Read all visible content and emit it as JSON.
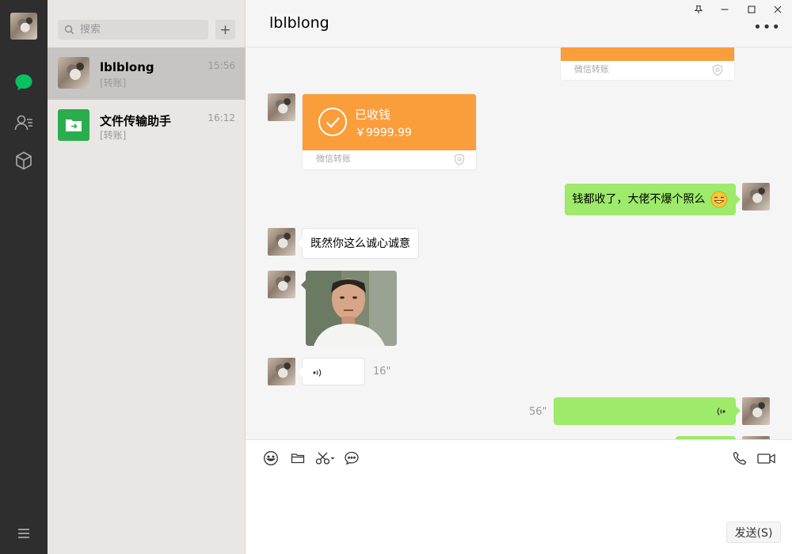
{
  "sidebar": {
    "nav": [
      "chat-icon",
      "contacts-icon",
      "favorites-icon",
      "menu-icon"
    ],
    "active_color": "#07c160"
  },
  "search": {
    "placeholder": "搜索",
    "add_label": "+"
  },
  "sessions": [
    {
      "name": "lblblong",
      "last": "[转账]",
      "time": "15:56",
      "active": true
    },
    {
      "name": "文件传输助手",
      "last": "[转账]",
      "time": "16:12",
      "active": false
    }
  ],
  "chat": {
    "title": "lblblong",
    "more": "•••",
    "window_controls": [
      "pin-icon",
      "minimize-icon",
      "maximize-icon",
      "close-icon"
    ],
    "messages": {
      "transfer_top_footer": "微信转账",
      "transfer_received": {
        "status": "已收钱",
        "amount": "￥9999.99",
        "footer": "微信转账"
      },
      "sent_text": "钱都收了，大佬不爆个照么",
      "recv_text": "既然你这么诚心诚意",
      "recv_voice_duration": "16\"",
      "sent_voice_duration": "56\""
    }
  },
  "composer": {
    "tools": [
      "emoji-icon",
      "folder-icon",
      "scissors-icon",
      "chat-history-icon"
    ],
    "right_tools": [
      "phone-icon",
      "video-icon"
    ],
    "send_label": "发送(S)"
  },
  "colors": {
    "bubble_green": "#9eea6a",
    "transfer_orange": "#fa9d3b",
    "rail": "#2e2e2e"
  }
}
